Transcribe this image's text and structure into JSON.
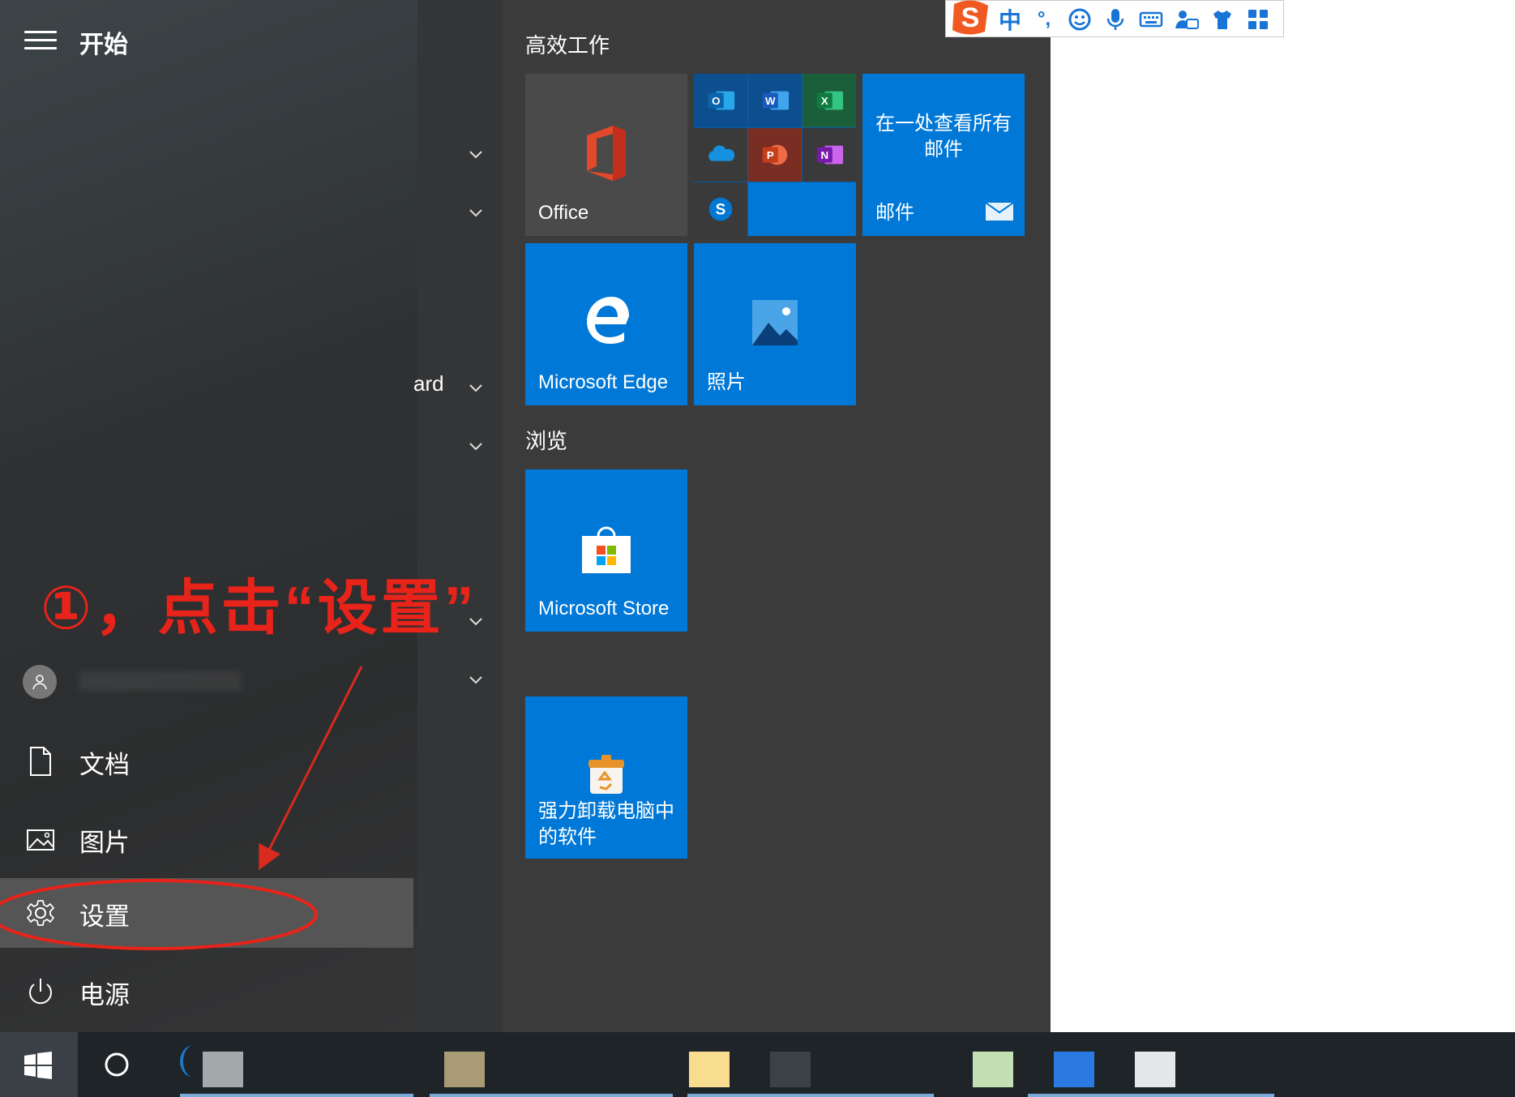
{
  "start": {
    "title": "开始",
    "partial_app_text": "ard"
  },
  "annotation": {
    "text": "①，点击“设置”",
    "color": "#e8231a"
  },
  "user": {
    "name_hidden": ""
  },
  "menu": {
    "documents": "文档",
    "pictures": "图片",
    "settings": "设置",
    "power": "电源"
  },
  "groups": {
    "productivity": "高效工作",
    "browse": "浏览"
  },
  "tiles": {
    "office": "Office",
    "mail_line1": "在一处查看所有",
    "mail_line2": "邮件",
    "mail_label": "邮件",
    "edge": "Microsoft Edge",
    "photos": "照片",
    "store": "Microsoft Store",
    "uninstall_line1": "强力卸载电脑中",
    "uninstall_line2": "的软件"
  },
  "office_mini": {
    "outlook": "O",
    "word": "W",
    "excel": "X",
    "powerpoint": "P",
    "onenote": "N",
    "skype": "S"
  },
  "ime": {
    "logo": "S",
    "lang": "中",
    "punct": "°,"
  },
  "colors": {
    "accent": "#0078d7",
    "annotation": "#e8231a",
    "menu_bg": "#3a3a3a",
    "taskbar": "#1e2428"
  }
}
